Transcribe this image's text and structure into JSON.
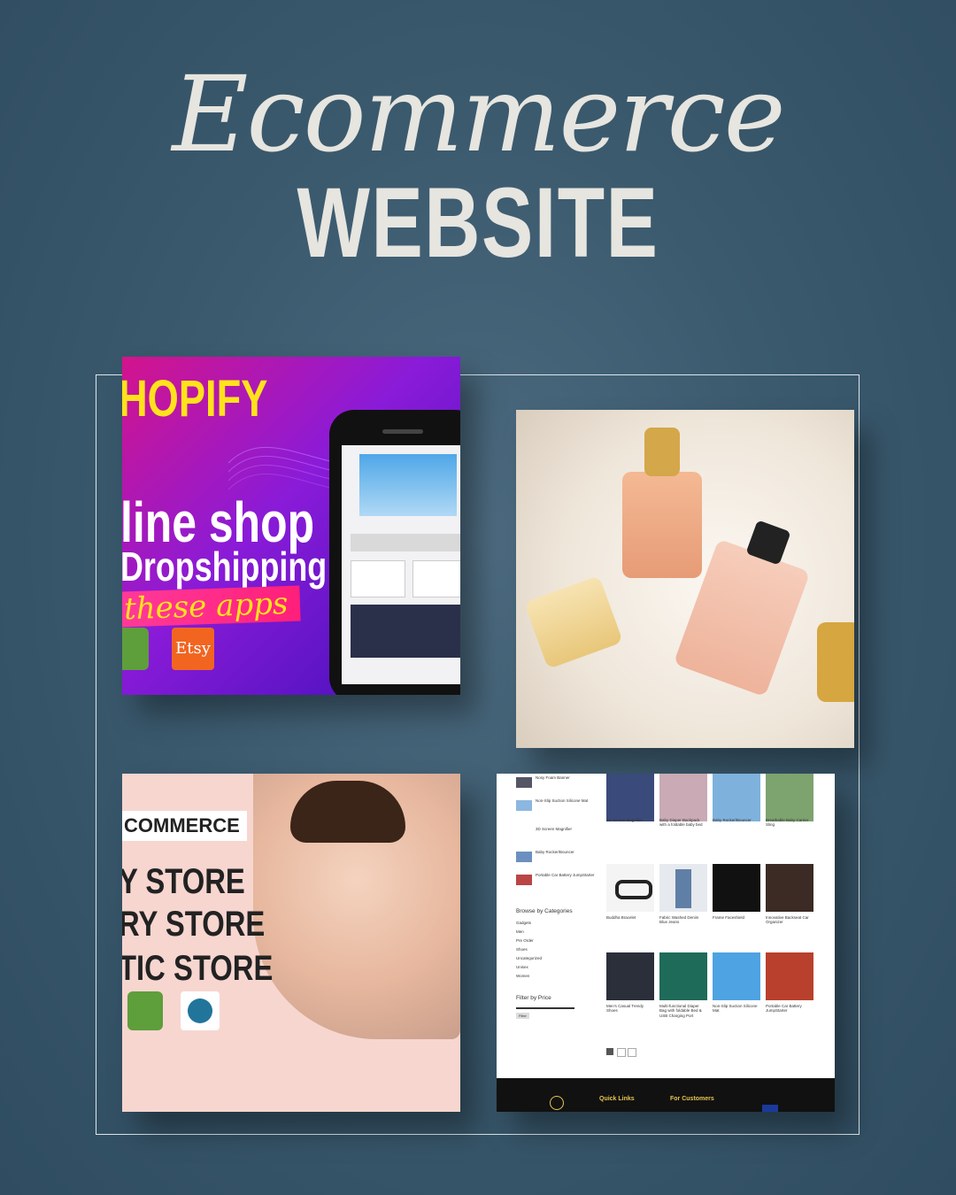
{
  "heading": {
    "script": "Ecommerce",
    "main": "WEBSITE"
  },
  "card1": {
    "line1": "HOPIFY",
    "line2": "line shop",
    "line3": "Dropshipping",
    "line4": "these apps",
    "etsy": "Etsy"
  },
  "card3": {
    "label": "COMMERCE",
    "line1": "Y STORE",
    "line2": "RY STORE",
    "line3": "TIC STORE"
  },
  "card4": {
    "sidebar_items": [
      "Nosy Foam Banner",
      "Non-Slip Suction Silicone Mat",
      "3D Screen Magnifier",
      "Baby Rocker/Bouncer",
      "Portable Car Battery JumpStarter"
    ],
    "categories_title": "Browse by Categories",
    "categories": [
      "Gadgets",
      "Men",
      "Pre Order",
      "Shoes",
      "Uncategorized",
      "Unisex",
      "Women"
    ],
    "filter_title": "Filter by Price",
    "filter_button": "Filter",
    "products": [
      "3D Screen Magnifier",
      "Baby Diaper Backpack with a foldable baby bed",
      "Baby Rocker/Bouncer",
      "Breathable Baby Carrier Sling",
      "Buddha Bracelet",
      "Fabric Washed Denim Blue Jeans",
      "Frame Faceshield",
      "Innovative Backseat Car Organizer",
      "Men's Casual Trendy Shoes",
      "Multi-functional Diaper Bag with foldable Bed & USB Charging Port",
      "Non-Slip Suction Silicone Mat",
      "Portable Car Battery JumpStarter"
    ],
    "footer_links": [
      "Quick Links",
      "For Customers"
    ]
  }
}
